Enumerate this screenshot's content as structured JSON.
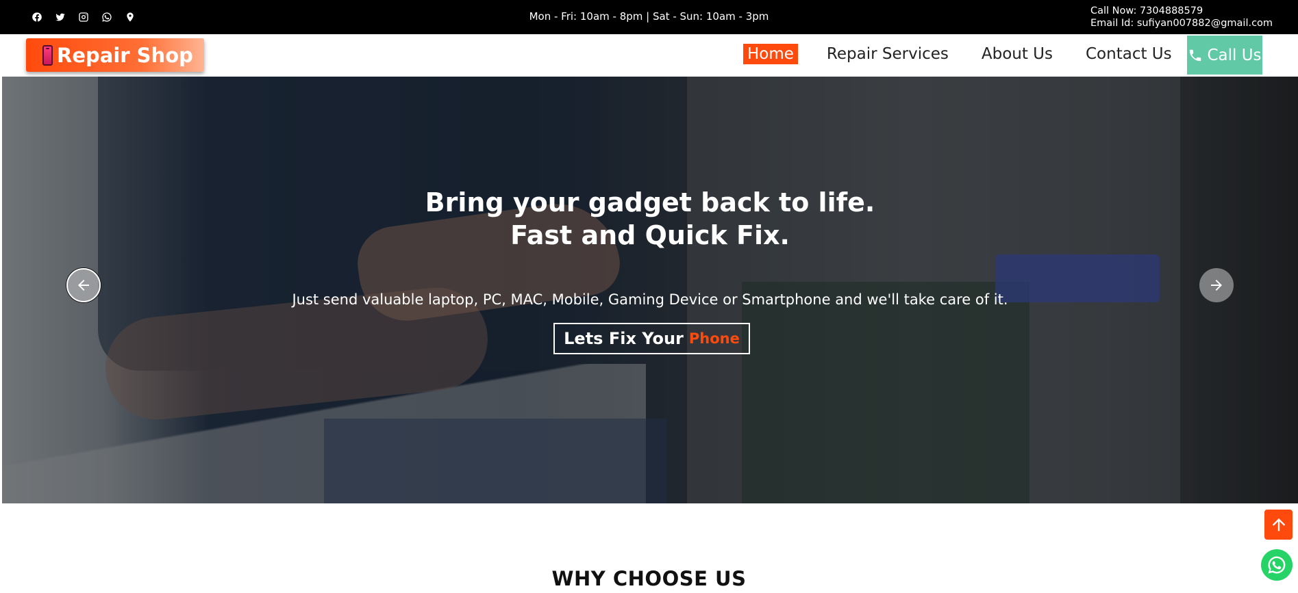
{
  "topbar": {
    "social_icons": [
      "facebook-icon",
      "twitter-icon",
      "instagram-icon",
      "whatsapp-icon",
      "location-pin-icon"
    ],
    "hours": "Mon - Fri: 10am - 8pm | Sat - Sun: 10am - 3pm",
    "call_now": "Call Now: 7304888579",
    "email": "Email Id: sufiyan007882@gmail.com"
  },
  "navbar": {
    "logo_text": "Repair Shop",
    "links": [
      {
        "label": "Home",
        "active": true
      },
      {
        "label": "Repair Services",
        "active": false
      },
      {
        "label": "About Us",
        "active": false
      },
      {
        "label": "Contact Us",
        "active": false
      }
    ],
    "call_button": "Call Us"
  },
  "hero": {
    "title_line1": "Bring your gadget back to life.",
    "title_line2": "Fast and Quick Fix.",
    "subtitle": "Just send valuable laptop, PC, MAC, Mobile, Gaming Device or Smartphone and we'll take care of it.",
    "cta_prefix": "Lets Fix Your",
    "cta_highlight": "Phone"
  },
  "section": {
    "title": "WHY CHOOSE US"
  },
  "colors": {
    "accent": "#ff4a0d",
    "call_button": "#62c9a6",
    "topbar_bg": "#000000",
    "whatsapp": "#25d366"
  }
}
